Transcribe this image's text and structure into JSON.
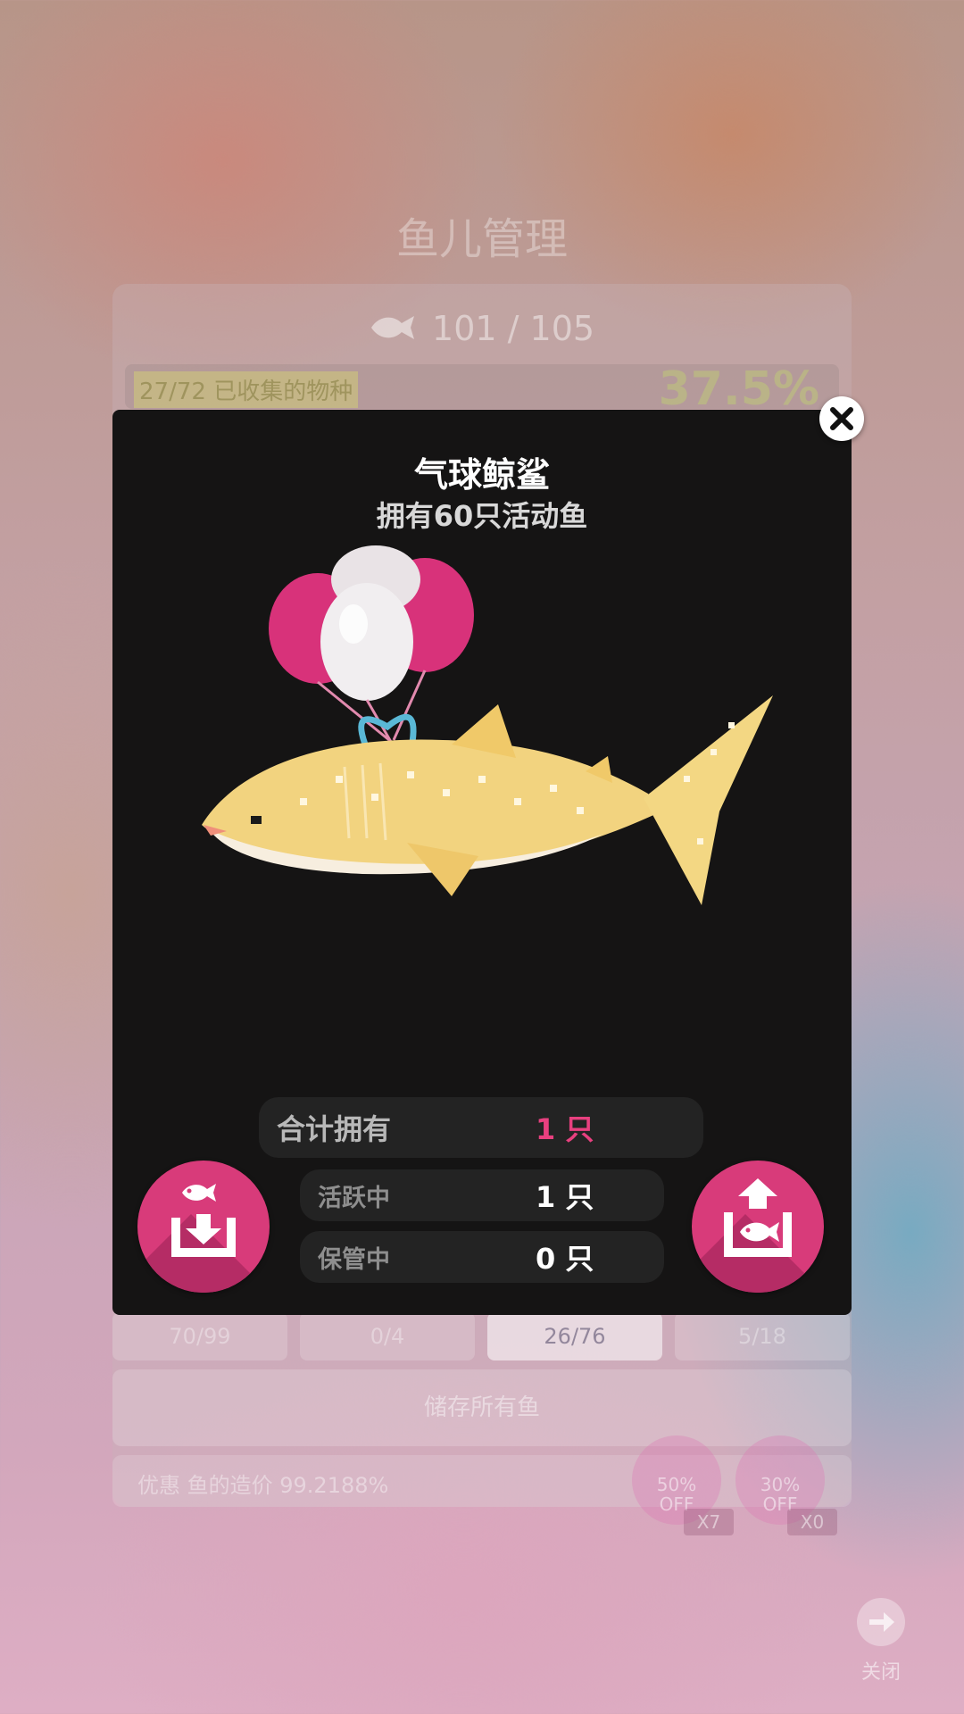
{
  "background": {
    "title": "鱼儿管理",
    "fish_count": "101 / 105",
    "collected_label": "27/72 已收集的物种",
    "collection_percent": "37.5%",
    "tabs": [
      "70/99",
      "0/4",
      "26/76",
      "5/18"
    ],
    "store_all_label": "储存所有鱼",
    "discount_text": "优惠 鱼的造价 99.2188%",
    "coupons": [
      {
        "percent": "50%",
        "off": "OFF",
        "multiplier": "X7"
      },
      {
        "percent": "30%",
        "off": "OFF",
        "multiplier": "X0"
      }
    ],
    "close_label": "关闭"
  },
  "modal": {
    "fish_name": "气球鲸鲨",
    "subtitle": "拥有60只活动鱼",
    "stats": {
      "total_label": "合计拥有",
      "total_value": "1 只",
      "active_label": "活跃中",
      "active_value": "1 只",
      "stored_label": "保管中",
      "stored_value": "0 只"
    }
  },
  "colors": {
    "accent": "#d83b7a",
    "modal_bg": "#151414",
    "highlight_value": "#e8407f"
  },
  "icons": {
    "close": "close-icon",
    "store": "fish-store-icon",
    "release": "fish-release-icon"
  }
}
